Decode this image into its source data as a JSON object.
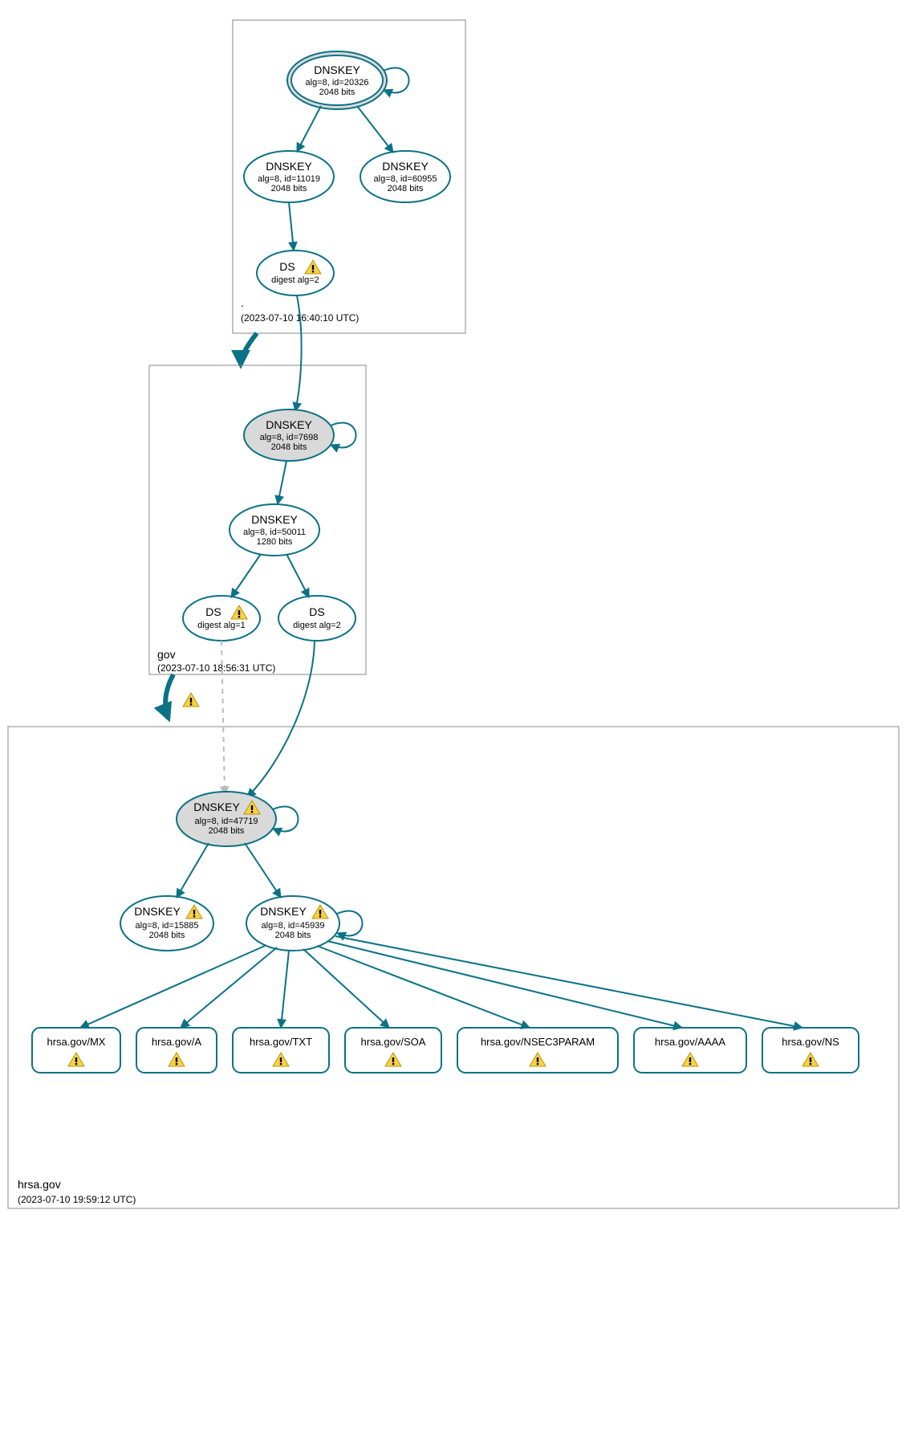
{
  "colors": {
    "accent": "#0b7285",
    "node_fill_grey": "#d9d9d9",
    "warning_fill": "#f6d346",
    "warning_stroke": "#bd9304"
  },
  "zones": {
    "root": {
      "name": ".",
      "timestamp": "(2023-07-10 16:40:10 UTC)"
    },
    "gov": {
      "name": "gov",
      "timestamp": "(2023-07-10 18:56:31 UTC)"
    },
    "hrsa": {
      "name": "hrsa.gov",
      "timestamp": "(2023-07-10 19:59:12 UTC)"
    }
  },
  "nodes": {
    "root_ksk": {
      "title": "DNSKEY",
      "sub1": "alg=8, id=20326",
      "sub2": "2048 bits"
    },
    "root_zsk1": {
      "title": "DNSKEY",
      "sub1": "alg=8, id=11019",
      "sub2": "2048 bits"
    },
    "root_zsk2": {
      "title": "DNSKEY",
      "sub1": "alg=8, id=60955",
      "sub2": "2048 bits"
    },
    "root_ds": {
      "title": "DS",
      "sub1": "digest alg=2"
    },
    "gov_ksk": {
      "title": "DNSKEY",
      "sub1": "alg=8, id=7698",
      "sub2": "2048 bits"
    },
    "gov_zsk": {
      "title": "DNSKEY",
      "sub1": "alg=8, id=50011",
      "sub2": "1280 bits"
    },
    "gov_ds1": {
      "title": "DS",
      "sub1": "digest alg=1"
    },
    "gov_ds2": {
      "title": "DS",
      "sub1": "digest alg=2"
    },
    "hrsa_ksk": {
      "title": "DNSKEY",
      "sub1": "alg=8, id=47719",
      "sub2": "2048 bits"
    },
    "hrsa_zsk1": {
      "title": "DNSKEY",
      "sub1": "alg=8, id=15885",
      "sub2": "2048 bits"
    },
    "hrsa_zsk2": {
      "title": "DNSKEY",
      "sub1": "alg=8, id=45939",
      "sub2": "2048 bits"
    }
  },
  "rr": {
    "mx": "hrsa.gov/MX",
    "a": "hrsa.gov/A",
    "txt": "hrsa.gov/TXT",
    "soa": "hrsa.gov/SOA",
    "nsec3": "hrsa.gov/NSEC3PARAM",
    "aaaa": "hrsa.gov/AAAA",
    "ns": "hrsa.gov/NS"
  }
}
